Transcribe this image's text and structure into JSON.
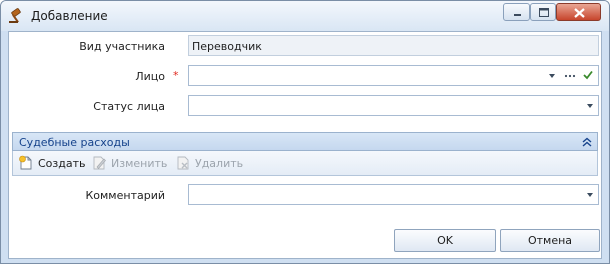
{
  "window": {
    "title": "Добавление"
  },
  "form": {
    "participant_type": {
      "label": "Вид участника",
      "value": "Переводчик"
    },
    "person": {
      "label": "Лицо",
      "required_mark": "*",
      "value": ""
    },
    "person_status": {
      "label": "Статус лица",
      "value": ""
    },
    "comment": {
      "label": "Комментарий",
      "value": ""
    }
  },
  "court_costs": {
    "title": "Судебные расходы",
    "toolbar": {
      "create_label": "Создать",
      "edit_label": "Изменить",
      "delete_label": "Удалить"
    }
  },
  "buttons": {
    "ok_label": "OK",
    "cancel_label": "Отмена"
  },
  "colors": {
    "accent": "#15428b",
    "required": "#e0281e",
    "confirm_check": "#3a8a2c"
  }
}
